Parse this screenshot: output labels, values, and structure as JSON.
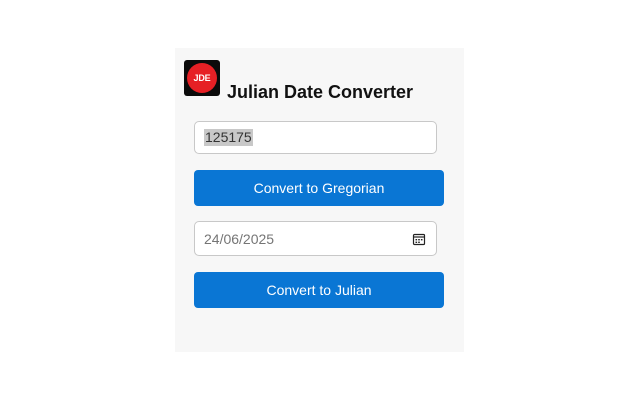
{
  "app": {
    "title": "Julian Date Converter",
    "logo_text": "JDE"
  },
  "julian_input": {
    "value": "125175"
  },
  "gregorian_button": {
    "label": "Convert to Gregorian"
  },
  "date_input": {
    "value": "24/06/2025",
    "icon": "calendar-icon"
  },
  "julian_button": {
    "label": "Convert to Julian"
  },
  "colors": {
    "accent": "#0a76d4",
    "logo_red": "#e62025",
    "panel_bg": "#f7f7f7"
  }
}
